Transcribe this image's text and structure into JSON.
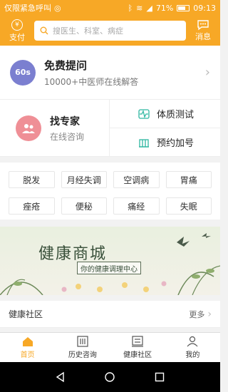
{
  "status_bar": {
    "carrier": "仅限紧急呼叫",
    "battery": "71%",
    "time": "09:13"
  },
  "topbar": {
    "pay_icon_glyph": "¥",
    "pay_label": "支付",
    "search_placeholder": "搜医生、科室、病症",
    "message_label": "消息"
  },
  "free_ask": {
    "badge": "60s",
    "title": "免费提问",
    "subtitle": "10000+中医师在线解答"
  },
  "expert": {
    "title": "找专家",
    "subtitle": "在线咨询"
  },
  "quick_links": [
    {
      "label": "体质测试",
      "icon": "pulse-icon"
    },
    {
      "label": "预约加号",
      "icon": "hospital-icon"
    }
  ],
  "symptom_tags": [
    "脱发",
    "月经失调",
    "空调病",
    "胃痛",
    "痤疮",
    "便秘",
    "痛经",
    "失眠"
  ],
  "banner": {
    "title": "健康商城",
    "tagline": "你的健康调理中心"
  },
  "community": {
    "title": "健康社区",
    "more": "更多"
  },
  "tabs": [
    {
      "label": "首页",
      "icon": "home-icon",
      "active": true
    },
    {
      "label": "历史咨询",
      "icon": "history-icon",
      "active": false
    },
    {
      "label": "健康社区",
      "icon": "community-icon",
      "active": false
    },
    {
      "label": "我的",
      "icon": "profile-icon",
      "active": false
    }
  ],
  "colors": {
    "accent": "#f7a826",
    "badge_purple": "#7b7fd0",
    "expert_pink": "#ef8f96",
    "icon_green": "#2fb7a1"
  }
}
